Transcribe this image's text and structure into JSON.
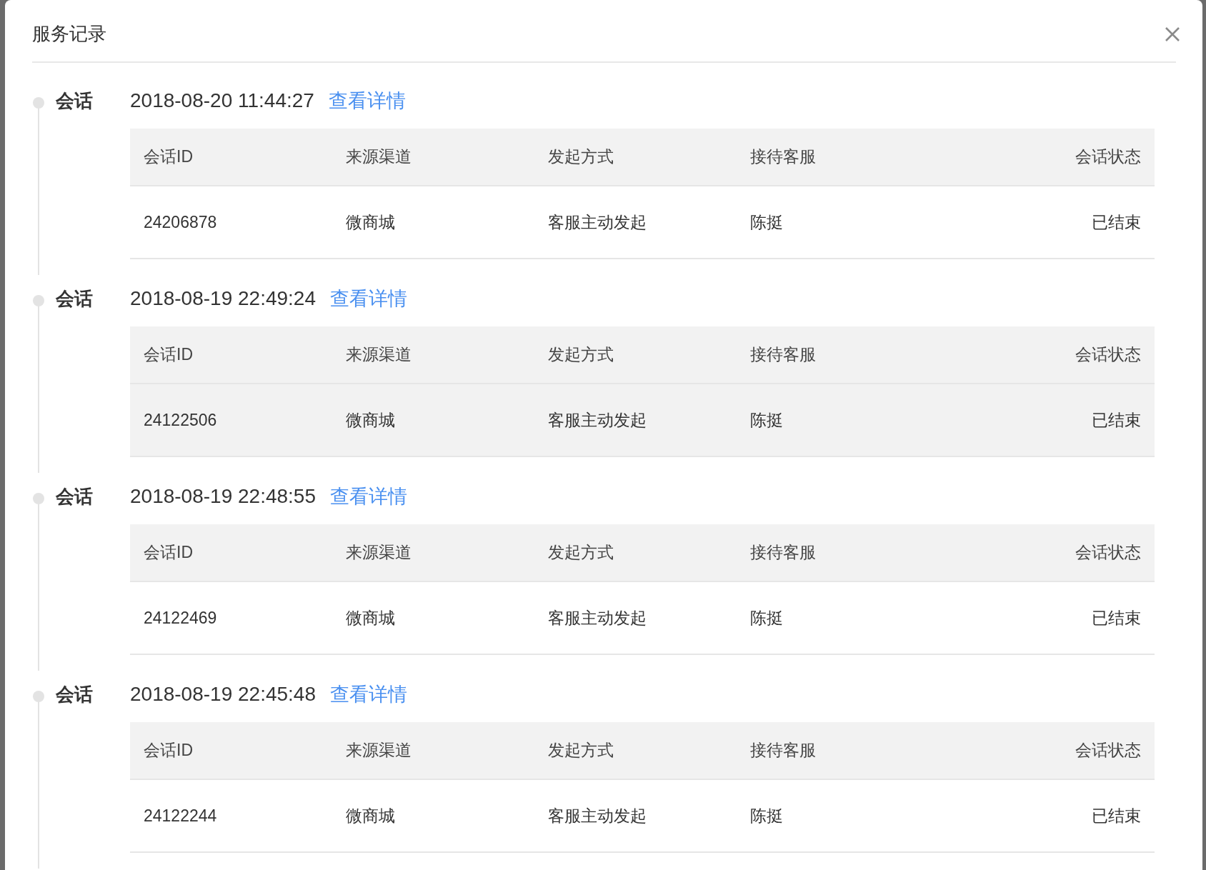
{
  "dialog": {
    "title": "服务记录"
  },
  "sessions": [
    {
      "label": "会话",
      "time": "2018-08-20 11:44:27",
      "link": "查看详情",
      "columns": [
        "会话ID",
        "来源渠道",
        "发起方式",
        "接待客服",
        "会话状态"
      ],
      "rows": [
        {
          "cells": [
            "24206878",
            "微商城",
            "客服主动发起",
            "陈挺",
            "已结束"
          ],
          "highlighted": false
        }
      ]
    },
    {
      "label": "会话",
      "time": "2018-08-19 22:49:24",
      "link": "查看详情",
      "columns": [
        "会话ID",
        "来源渠道",
        "发起方式",
        "接待客服",
        "会话状态"
      ],
      "rows": [
        {
          "cells": [
            "24122506",
            "微商城",
            "客服主动发起",
            "陈挺",
            "已结束"
          ],
          "highlighted": true
        }
      ]
    },
    {
      "label": "会话",
      "time": "2018-08-19 22:48:55",
      "link": "查看详情",
      "columns": [
        "会话ID",
        "来源渠道",
        "发起方式",
        "接待客服",
        "会话状态"
      ],
      "rows": [
        {
          "cells": [
            "24122469",
            "微商城",
            "客服主动发起",
            "陈挺",
            "已结束"
          ],
          "highlighted": false
        }
      ]
    },
    {
      "label": "会话",
      "time": "2018-08-19 22:45:48",
      "link": "查看详情",
      "columns": [
        "会话ID",
        "来源渠道",
        "发起方式",
        "接待客服",
        "会话状态"
      ],
      "rows": [
        {
          "cells": [
            "24122244",
            "微商城",
            "客服主动发起",
            "陈挺",
            "已结束"
          ],
          "highlighted": false
        }
      ]
    }
  ]
}
